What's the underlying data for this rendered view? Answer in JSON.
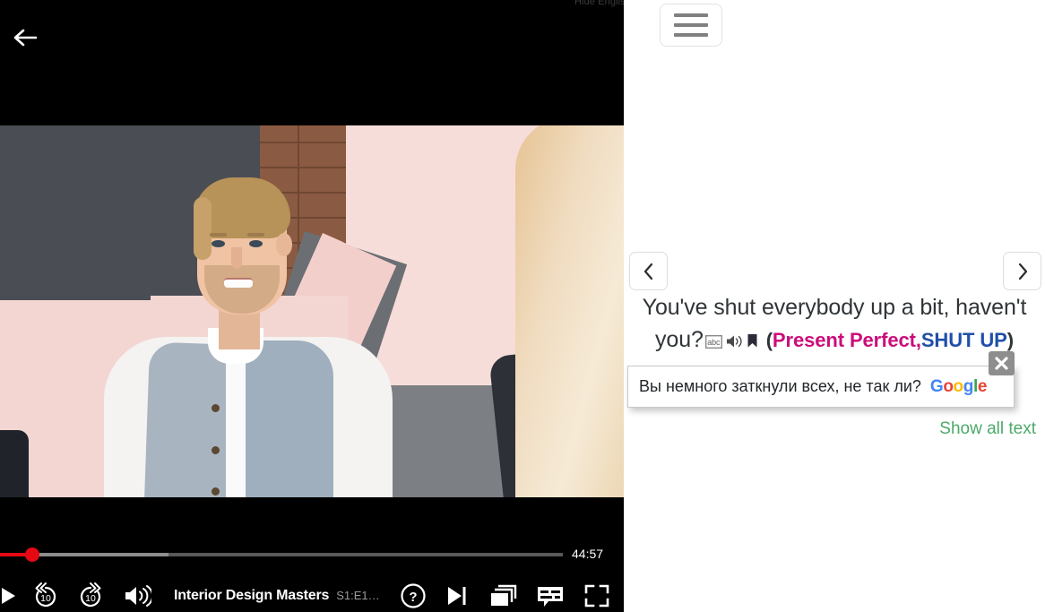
{
  "player": {
    "back_icon": "back-arrow-icon",
    "hide_english_label": "Hide English",
    "time_remaining": "44:57",
    "now_playing_title": "Interior Design Masters",
    "now_playing_episode": "S1:E1…",
    "controls": {
      "play_label": "play-icon",
      "rewind_label": "10",
      "forward_label": "10",
      "volume_label": "volume-icon",
      "help_label": "?",
      "next_episode_label": "next-episode-icon",
      "episodes_label": "episodes-icon",
      "subtitles_label": "subtitles-icon",
      "fullscreen_label": "fullscreen-icon"
    },
    "progress": {
      "played_percent": 5,
      "buffered_percent": 30
    }
  },
  "panel": {
    "menu_button": "menu-icon",
    "prev_button": "‹",
    "next_button": "›",
    "subtitle": {
      "line1": "You've shut everybody up a bit, haven't",
      "line2_prefix": "you?",
      "icons": [
        "abc-icon",
        "speaker-icon",
        "bookmark-icon"
      ],
      "open_paren": "(",
      "keyword1": "Present Perfect",
      "separator": ",",
      "keyword2": "SHUT UP",
      "close_paren": ")"
    },
    "translation": {
      "text": "Вы немного заткнули всех, не так ли?",
      "provider": "Google",
      "provider_letters": [
        "G",
        "o",
        "o",
        "g",
        "l",
        "e"
      ],
      "close_button": "close-icon"
    },
    "show_all_text": "Show all text"
  },
  "colors": {
    "accent_red": "#e50914",
    "keyword_magenta": "#cc0d7a",
    "keyword_blue": "#1f4fa8",
    "link_green": "#4da96a",
    "panel_bg": "#ffffff",
    "player_bg": "#000000"
  }
}
